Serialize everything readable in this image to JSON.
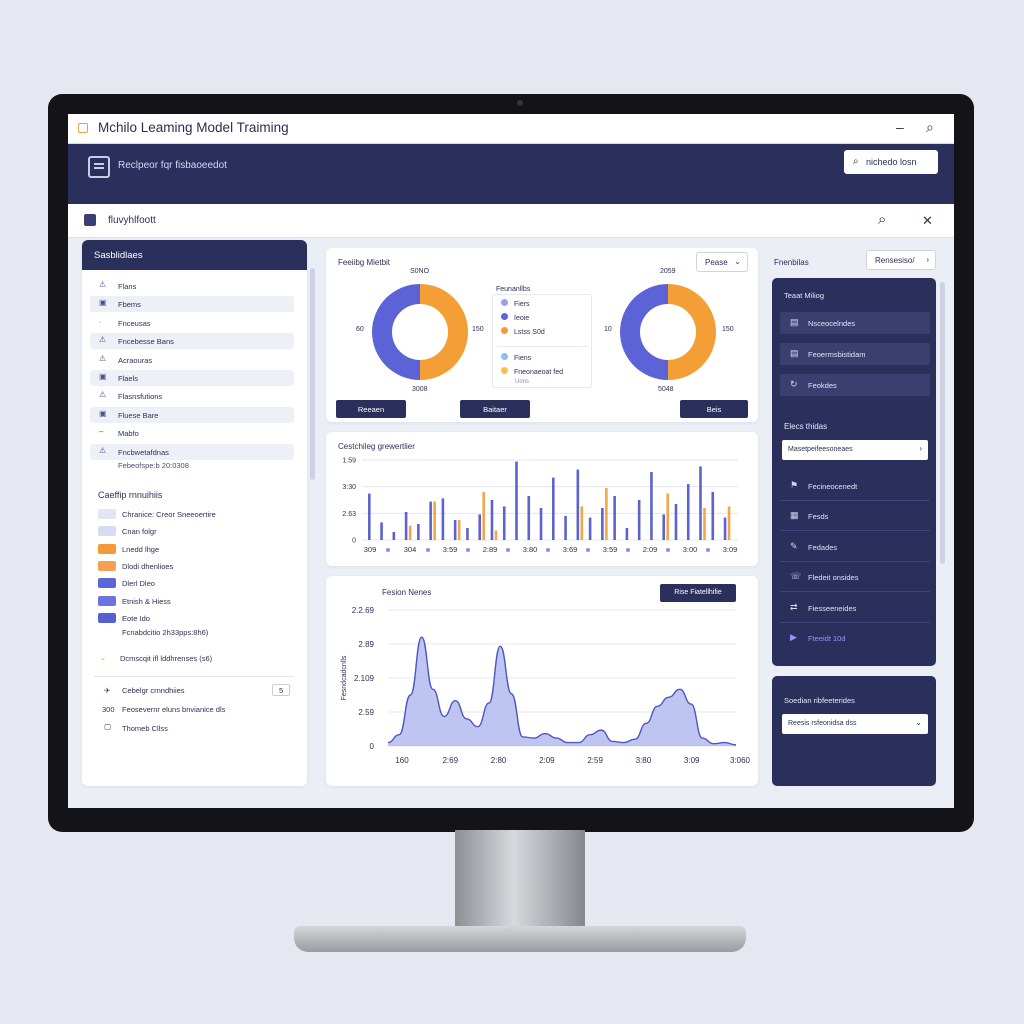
{
  "window": {
    "title": "Mchilo Leaming Model Traiming",
    "minimize": "–",
    "search_glyph": "⌕"
  },
  "header": {
    "text": "Reclpeor fqr fisbaoeedot",
    "button": "nichedo losn"
  },
  "toolbar": {
    "title": "fluvyhlfoott",
    "search_glyph": "⌕",
    "close_glyph": "✕"
  },
  "sidebar": {
    "title": "Sasblidlaes",
    "items": [
      {
        "label": "Flans",
        "icon": "triangle-icon"
      },
      {
        "label": "Fbems",
        "icon": "square-icon"
      },
      {
        "label": "Fnceusas",
        "icon": "dot-icon"
      },
      {
        "label": "Fncebesse Bans",
        "icon": "triangle-icon"
      },
      {
        "label": "Acraouras",
        "icon": "triangle-icon"
      },
      {
        "label": "Flaels",
        "icon": "square-icon"
      },
      {
        "label": "Flasnsfutions",
        "icon": "triangle-icon"
      },
      {
        "label": "Fluese Bare",
        "icon": "square-icon"
      },
      {
        "label": "Mabfo",
        "icon": "dash-icon"
      },
      {
        "label": "Fncbwetafdnas",
        "icon": "triangle-icon"
      }
    ],
    "status_text": "Febeofspe:b  20:0308",
    "legend_title": "Caeffip rnnuihiis",
    "legend": [
      {
        "label": "Chranice: Creor Sneeoertire",
        "color": "#e3e5f4"
      },
      {
        "label": "Cnan folgr",
        "color": "#d7dbf2"
      },
      {
        "label": "Lnedd lhge",
        "color": "#f39a3a"
      },
      {
        "label": "Dlodi dhenlioes",
        "color": "#f4a054"
      },
      {
        "label": "Dlerl Dleo",
        "color": "#5d66d6"
      },
      {
        "label": "Etnish & Hiess",
        "color": "#6b74dc"
      },
      {
        "label": "Eote Ido",
        "color": "#5660d0"
      }
    ],
    "legend_note": "Fcnabdcitio 2h33pps:8h6)",
    "metric_line": "Dcmscqit ifl lddhrenses (s6)",
    "footer": [
      {
        "label": "Cebelgr crnndhiies",
        "value": "5"
      },
      {
        "label": "Feosevernr eluns bnvianice dls",
        "prefix": "300"
      },
      {
        "label": "Thomeb Cllss"
      }
    ]
  },
  "donut_panel": {
    "title": "Feeiibg Mietbit",
    "dropdown": "Pease",
    "donut_left": {
      "top": "S0NO",
      "left": "60",
      "right": "150",
      "bottom": "3008",
      "blue_fraction": 0.5
    },
    "donut_right": {
      "top": "2059",
      "left": "10",
      "right": "150",
      "bottom": "5048",
      "blue_fraction": 0.5
    },
    "legend_title": "Feunanllbs",
    "legend_top": [
      {
        "label": "Fiers",
        "color": "#9aa2ea"
      },
      {
        "label": "Ieoie",
        "color": "#5c66d8"
      },
      {
        "label": "Lstss S0d",
        "color": "#f39a3a"
      }
    ],
    "legend_bottom": [
      {
        "label": "Fiens",
        "color": "#8fbdf0"
      },
      {
        "label": "Fneonaeoat fed",
        "color": "#f6c04a"
      }
    ],
    "legend_note": "Uons",
    "buttons": [
      "Reeaen",
      "Baitaer",
      "Beis"
    ]
  },
  "bar_panel": {
    "title": "Cestchileg grewertlier"
  },
  "area_panel": {
    "title": "Fesion Nenes",
    "button": "Rise Fiatellhifie"
  },
  "right": {
    "title": "Fnenbilas",
    "dropdown": "Rensesiso/",
    "panel1_title": "Teaat Miliog",
    "panel1_items": [
      {
        "label": "Nsceocelndes",
        "icon": "folder-icon"
      },
      {
        "label": "Feoermsbistidam",
        "icon": "folder-icon"
      },
      {
        "label": "Feokdes",
        "icon": "refresh-icon"
      }
    ],
    "section_title": "Elecs thidas",
    "input": "Masetpeifeesoneaes",
    "list_items": [
      {
        "label": "Fecineocenedt",
        "icon": "flag-icon"
      },
      {
        "label": "Fesds",
        "icon": "calendar-icon"
      },
      {
        "label": "Fedades",
        "icon": "wrench-icon"
      },
      {
        "label": "Fledeit onsides",
        "icon": "phone-icon"
      },
      {
        "label": "Fiesseeneides",
        "icon": "share-icon"
      },
      {
        "label": "Fteeidt 10d",
        "icon": "play-icon"
      }
    ],
    "panel2_title": "Soedian ribfeeterides",
    "panel2_select": "Reesis rsfeonidsa dss"
  },
  "chart_data": [
    {
      "type": "bar",
      "title": "Cestchileg grewertlier",
      "y_ticks": [
        "0",
        "2.63",
        "3:30",
        "1.59"
      ],
      "x_ticks": [
        "309",
        "304",
        "3:59",
        "2:89",
        "3:80",
        "3:69",
        "3:59",
        "2:09",
        "3:00",
        "3:09"
      ],
      "ylim": [
        0,
        100
      ],
      "series": [
        {
          "color": "#5b63cf",
          "values": [
            58,
            22,
            10,
            35,
            20,
            48,
            52,
            25,
            15,
            32,
            50,
            42,
            98,
            55,
            40,
            78,
            30,
            88,
            28,
            40,
            55,
            15,
            50,
            85,
            32,
            45,
            70,
            92,
            60,
            28
          ]
        },
        {
          "color": "#f3a54a",
          "values": [
            0,
            0,
            0,
            18,
            0,
            48,
            0,
            25,
            0,
            60,
            12,
            0,
            0,
            0,
            0,
            0,
            0,
            42,
            0,
            65,
            0,
            0,
            0,
            0,
            58,
            0,
            0,
            40,
            0,
            42
          ]
        }
      ]
    },
    {
      "type": "area",
      "title": "Fesion Nenes",
      "ylabel": "Fesndcadcnlls",
      "y_ticks": [
        "0",
        "2.59",
        "2.109",
        "2.89",
        "2.2.69"
      ],
      "x_ticks": [
        "160",
        "2:69",
        "2:80",
        "2:09",
        "2:59",
        "3:80",
        "3:09",
        "3:060"
      ],
      "ylim": [
        0,
        120
      ],
      "values": [
        3,
        10,
        45,
        96,
        50,
        26,
        40,
        24,
        17,
        38,
        88,
        46,
        8,
        7,
        11,
        7,
        3,
        3,
        10,
        14,
        4,
        3,
        6,
        20,
        35,
        43,
        50,
        37,
        7,
        2,
        3,
        1
      ]
    }
  ]
}
